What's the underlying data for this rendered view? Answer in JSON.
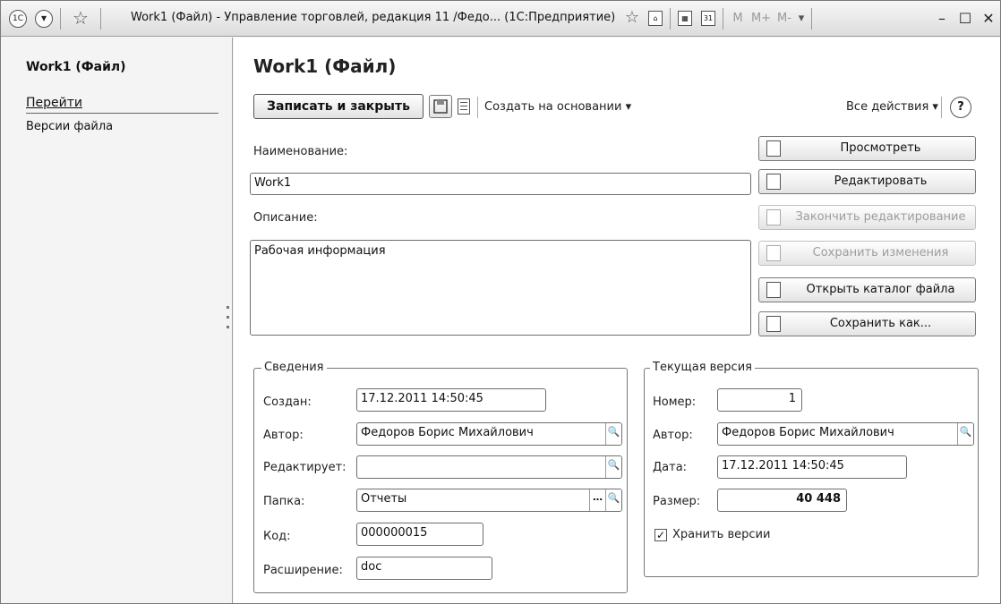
{
  "titlebar": {
    "title": "Work1 (Файл) - Управление торговлей, редакция 11 /Федо... (1С:Предприятие)",
    "app_icon": "1С",
    "memory_buttons": [
      "M",
      "M+",
      "M-"
    ]
  },
  "left_panel": {
    "title": "Work1 (Файл)",
    "nav_header": "Перейти",
    "items": [
      "Версии файла"
    ]
  },
  "form": {
    "title": "Work1 (Файл)",
    "toolbar": {
      "save_close": "Записать и закрыть",
      "create_based": "Создать на основании ▾",
      "all_actions": "Все действия ▾",
      "help": "?"
    },
    "name_label": "Наименование:",
    "name_value": "Work1",
    "desc_label": "Описание:",
    "desc_value": "Рабочая информация",
    "side_buttons": [
      {
        "label": "Просмотреть",
        "enabled": true
      },
      {
        "label": "Редактировать",
        "enabled": true
      },
      {
        "label": "Закончить редактирование",
        "enabled": false
      },
      {
        "label": "Сохранить изменения",
        "enabled": false
      },
      {
        "label": "Открыть каталог файла",
        "enabled": true
      },
      {
        "label": "Сохранить как...",
        "enabled": true
      }
    ],
    "info": {
      "title": "Сведения",
      "created_label": "Создан:",
      "created_value": "17.12.2011 14:50:45",
      "author_label": "Автор:",
      "author_value": "Федоров Борис Михайлович",
      "editing_label": "Редактирует:",
      "editing_value": "",
      "folder_label": "Папка:",
      "folder_value": "Отчеты",
      "code_label": "Код:",
      "code_value": "000000015",
      "ext_label": "Расширение:",
      "ext_value": "doc"
    },
    "version": {
      "title": "Текущая версия",
      "number_label": "Номер:",
      "number_value": "1",
      "author_label": "Автор:",
      "author_value": "Федоров Борис Михайлович",
      "date_label": "Дата:",
      "date_value": "17.12.2011 14:50:45",
      "size_label": "Размер:",
      "size_value": "40 448",
      "keep_label": "Хранить версии",
      "keep_checked": true
    }
  }
}
